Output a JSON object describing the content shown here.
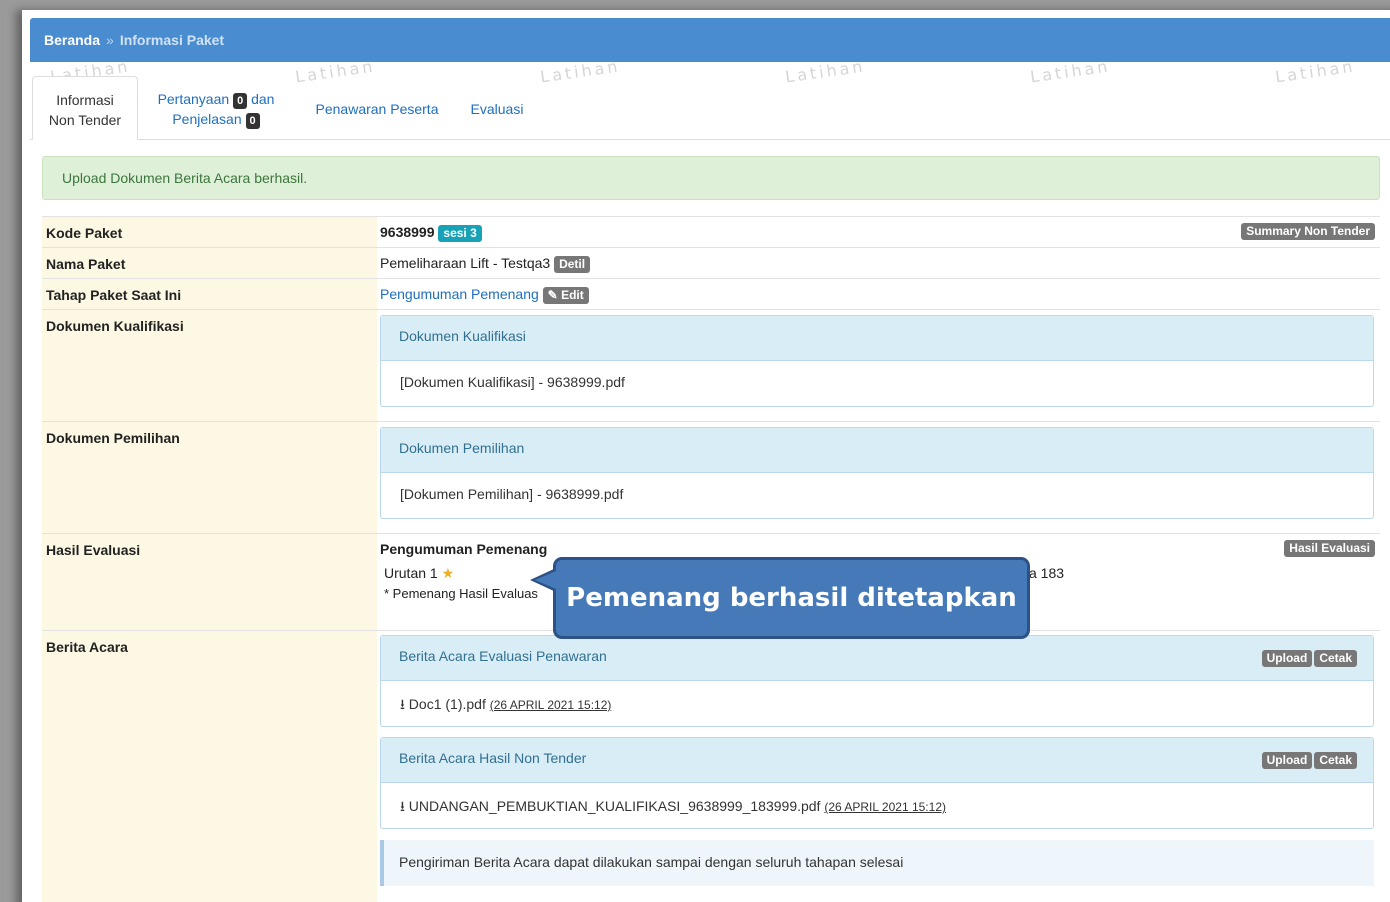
{
  "breadcrumb": {
    "home": "Beranda",
    "separator": "»",
    "current": "Informasi Paket"
  },
  "watermark": "Latihan",
  "tabs": [
    {
      "line1": "Informasi",
      "line2": "Non Tender"
    },
    {
      "part1": "Pertanyaan",
      "count1": "0",
      "part2": "dan",
      "part3": "Penjelasan",
      "count2": "0"
    },
    {
      "label": "Penawaran Peserta"
    },
    {
      "label": "Evaluasi"
    }
  ],
  "alert": "Upload Dokumen Berita Acara berhasil.",
  "rows": {
    "kode": {
      "label": "Kode Paket",
      "value": "9638999",
      "badge": "sesi 3",
      "action": "Summary Non Tender"
    },
    "nama": {
      "label": "Nama Paket",
      "value": "Pemeliharaan Lift - Testqa3",
      "action": "Detil"
    },
    "tahap": {
      "label": "Tahap Paket Saat Ini",
      "value": "Pengumuman Pemenang",
      "action": "Edit"
    },
    "kualifikasi": {
      "label": "Dokumen Kualifikasi",
      "panel_title": "Dokumen Kualifikasi",
      "file": "[Dokumen Kualifikasi] - 9638999.pdf"
    },
    "pemilihan": {
      "label": "Dokumen Pemilihan",
      "panel_title": "Dokumen Pemilihan",
      "file": "[Dokumen Pemilihan] - 9638999.pdf"
    },
    "hasil": {
      "label": "Hasil Evaluasi",
      "title": "Pengumuman Pemenang",
      "action": "Hasil Evaluasi",
      "urutan": "Urutan 1",
      "note": "* Pemenang Hasil Evaluas",
      "partial": "a 183"
    },
    "berita": {
      "label": "Berita Acara",
      "panels": [
        {
          "title": "Berita Acara Evaluasi Penawaran",
          "upload": "Upload",
          "cetak": "Cetak",
          "file": "Doc1 (1).pdf",
          "timestamp": "(26 APRIL 2021 15:12)"
        },
        {
          "title": "Berita Acara Hasil Non Tender",
          "upload": "Upload",
          "cetak": "Cetak",
          "file": "UNDANGAN_PEMBUKTIAN_KUALIFIKASI_9638999_183999.pdf",
          "timestamp": "(26 APRIL 2021 15:12)"
        }
      ],
      "note": "Pengiriman Berita Acara dapat dilakukan sampai dengan seluruh tahapan selesai"
    }
  },
  "callout": "Pemenang berhasil ditetapkan",
  "colors": {
    "header": "#4a8cd0",
    "callout": "#4579b7",
    "alert_bg": "#dff0d8",
    "label_bg": "#fcf8e3"
  }
}
